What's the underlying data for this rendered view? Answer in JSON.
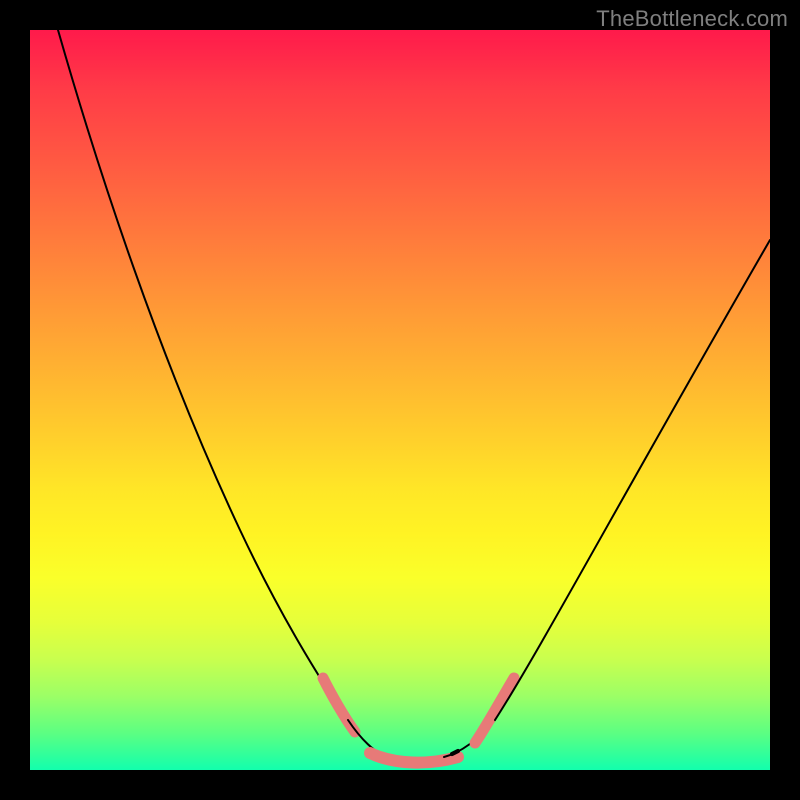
{
  "watermark": "TheBottleneck.com",
  "colors": {
    "background": "#000000",
    "curve": "#000000",
    "marker_accent": "#e77a78",
    "gradient_top": "#ff1a4b",
    "gradient_bottom": "#12ffad"
  },
  "chart_data": {
    "type": "line",
    "title": "",
    "xlabel": "",
    "ylabel": "",
    "xlim": [
      0,
      100
    ],
    "ylim": [
      0,
      100
    ],
    "grid": false,
    "legend": false,
    "series": [
      {
        "name": "bottleneck-curve",
        "x": [
          0,
          5,
          10,
          15,
          20,
          25,
          30,
          35,
          40,
          43,
          46,
          49,
          52,
          56,
          60,
          65,
          70,
          75,
          80,
          85,
          90,
          95,
          100
        ],
        "y": [
          100,
          90,
          79,
          67,
          55,
          43,
          31,
          20,
          10,
          5,
          2,
          1,
          1,
          2,
          5,
          11,
          19,
          28,
          37,
          46,
          55,
          64,
          72
        ]
      }
    ],
    "annotations": [
      {
        "name": "pink-marker-left",
        "x_range": [
          38,
          42
        ],
        "y_range": [
          5,
          11
        ]
      },
      {
        "name": "pink-marker-bottom",
        "x_range": [
          44,
          55
        ],
        "y_range": [
          1,
          3
        ]
      },
      {
        "name": "pink-marker-right",
        "x_range": [
          57,
          63
        ],
        "y_range": [
          3,
          10
        ]
      }
    ],
    "background_style": "vertical-rainbow-gradient"
  }
}
